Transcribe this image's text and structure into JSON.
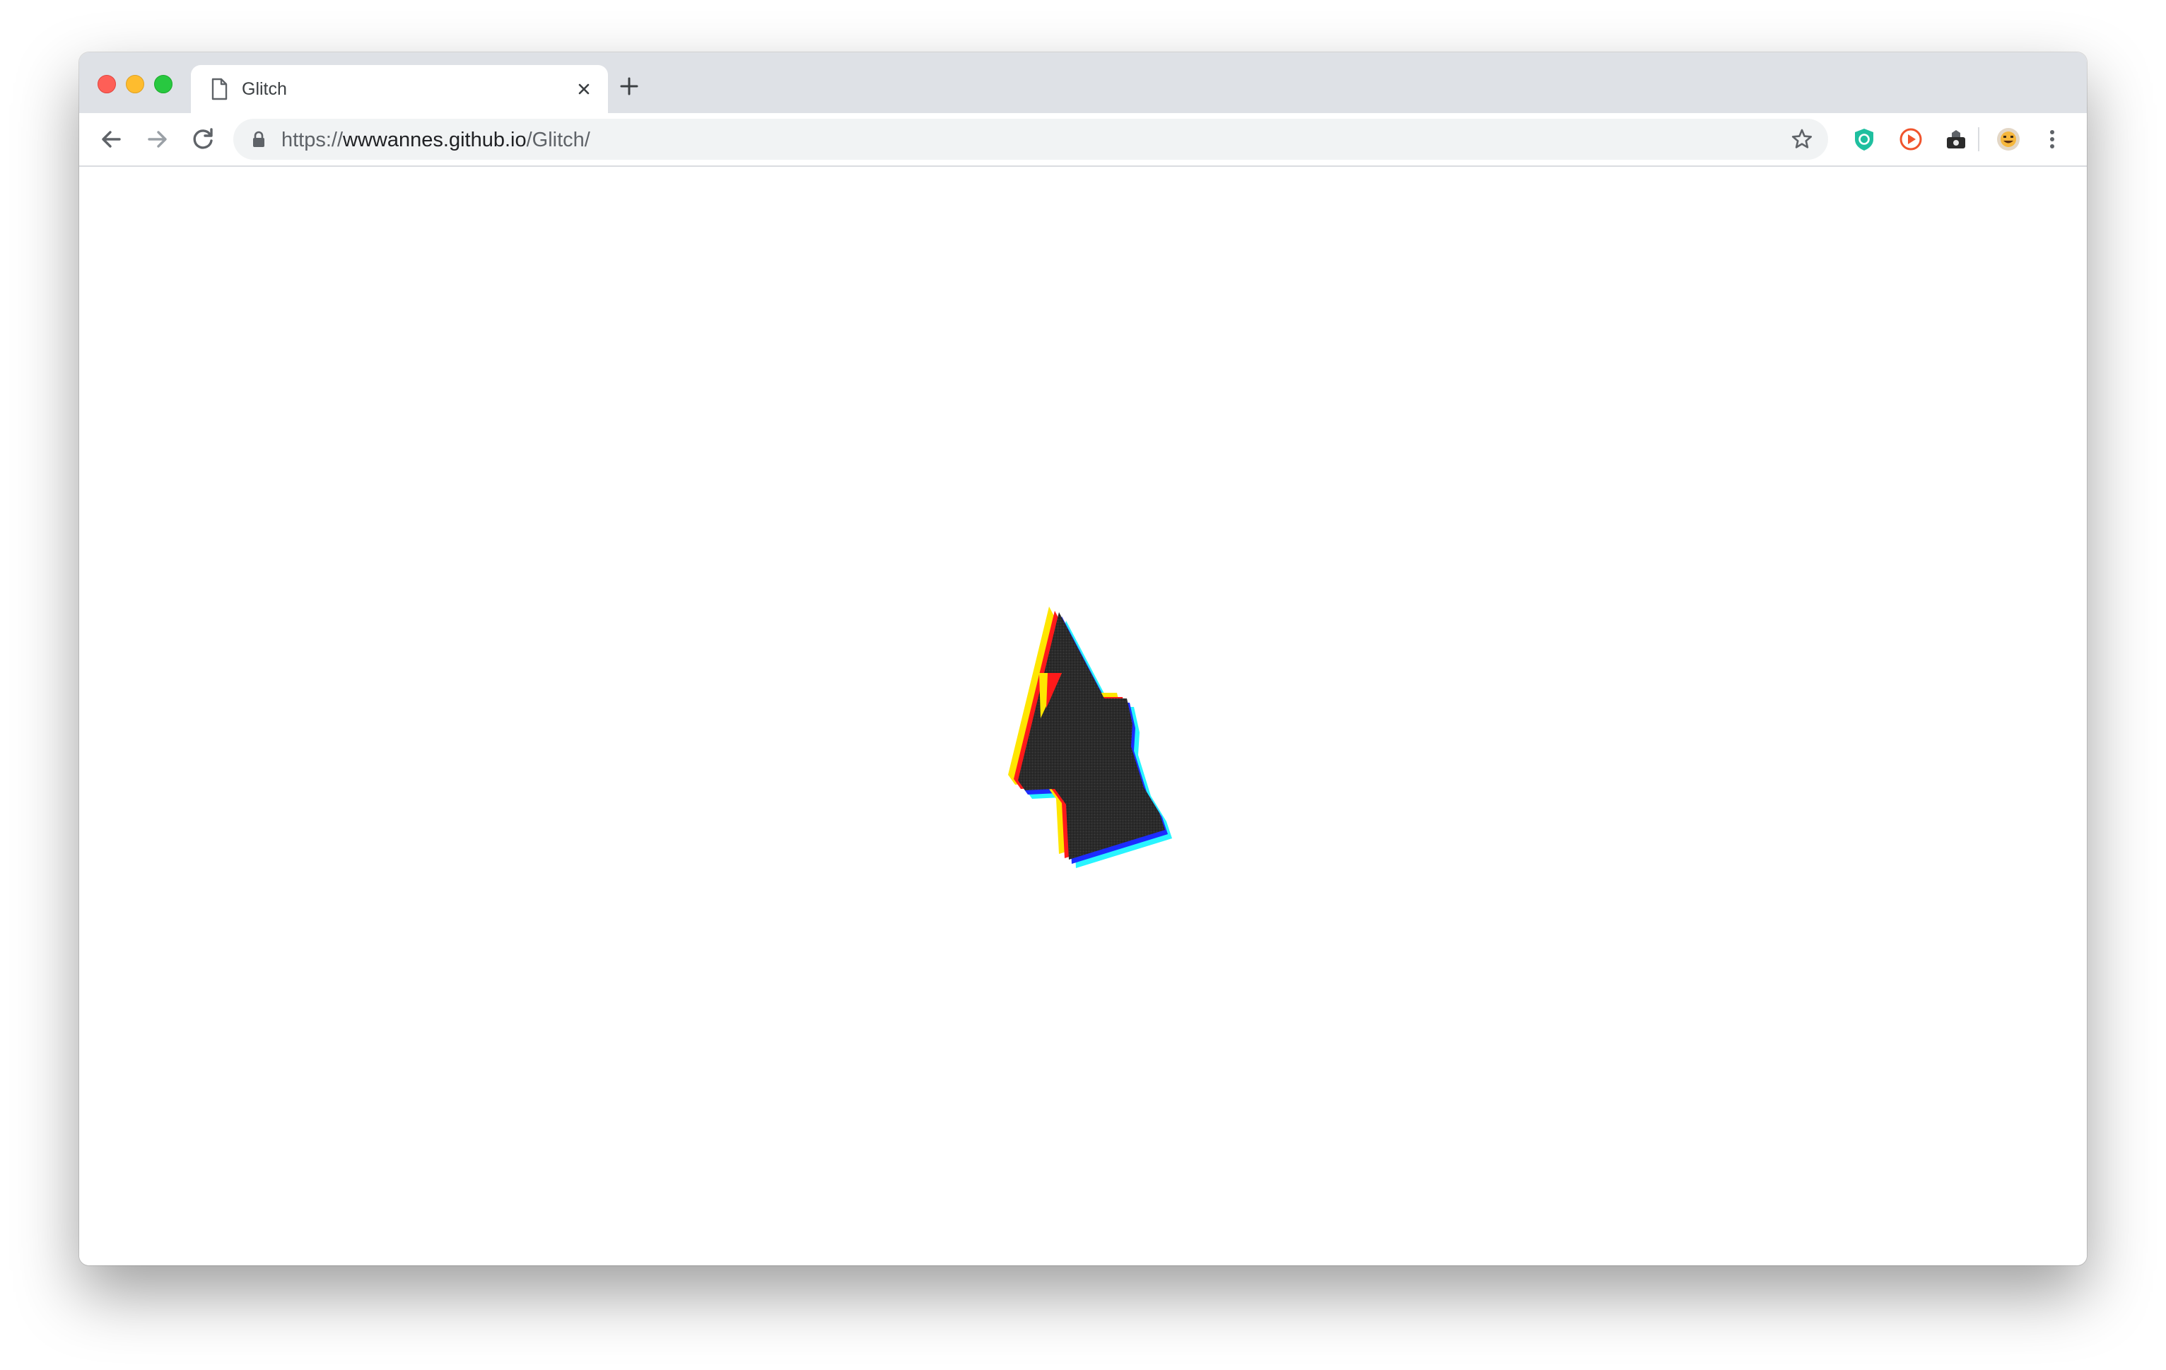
{
  "browser": {
    "tab": {
      "title": "Glitch",
      "icon": "page-icon"
    },
    "address_bar": {
      "scheme": "https://",
      "host": "wwwannes.github.io",
      "path": "/Glitch/"
    },
    "extensions": [
      "shield-check-icon",
      "play-circle-icon",
      "media-extension-icon"
    ],
    "colors": {
      "tab_strip": "#dee1e6",
      "omnibox": "#f1f3f4",
      "close": "#fe5f57",
      "minimize": "#febc2e",
      "maximize": "#28c840"
    }
  },
  "page": {
    "logo": {
      "name": "glitch-logo",
      "colors": [
        "#ffe600",
        "#ff1a1a",
        "#2b2b2b",
        "#1c2cff",
        "#28f4ff"
      ]
    }
  }
}
